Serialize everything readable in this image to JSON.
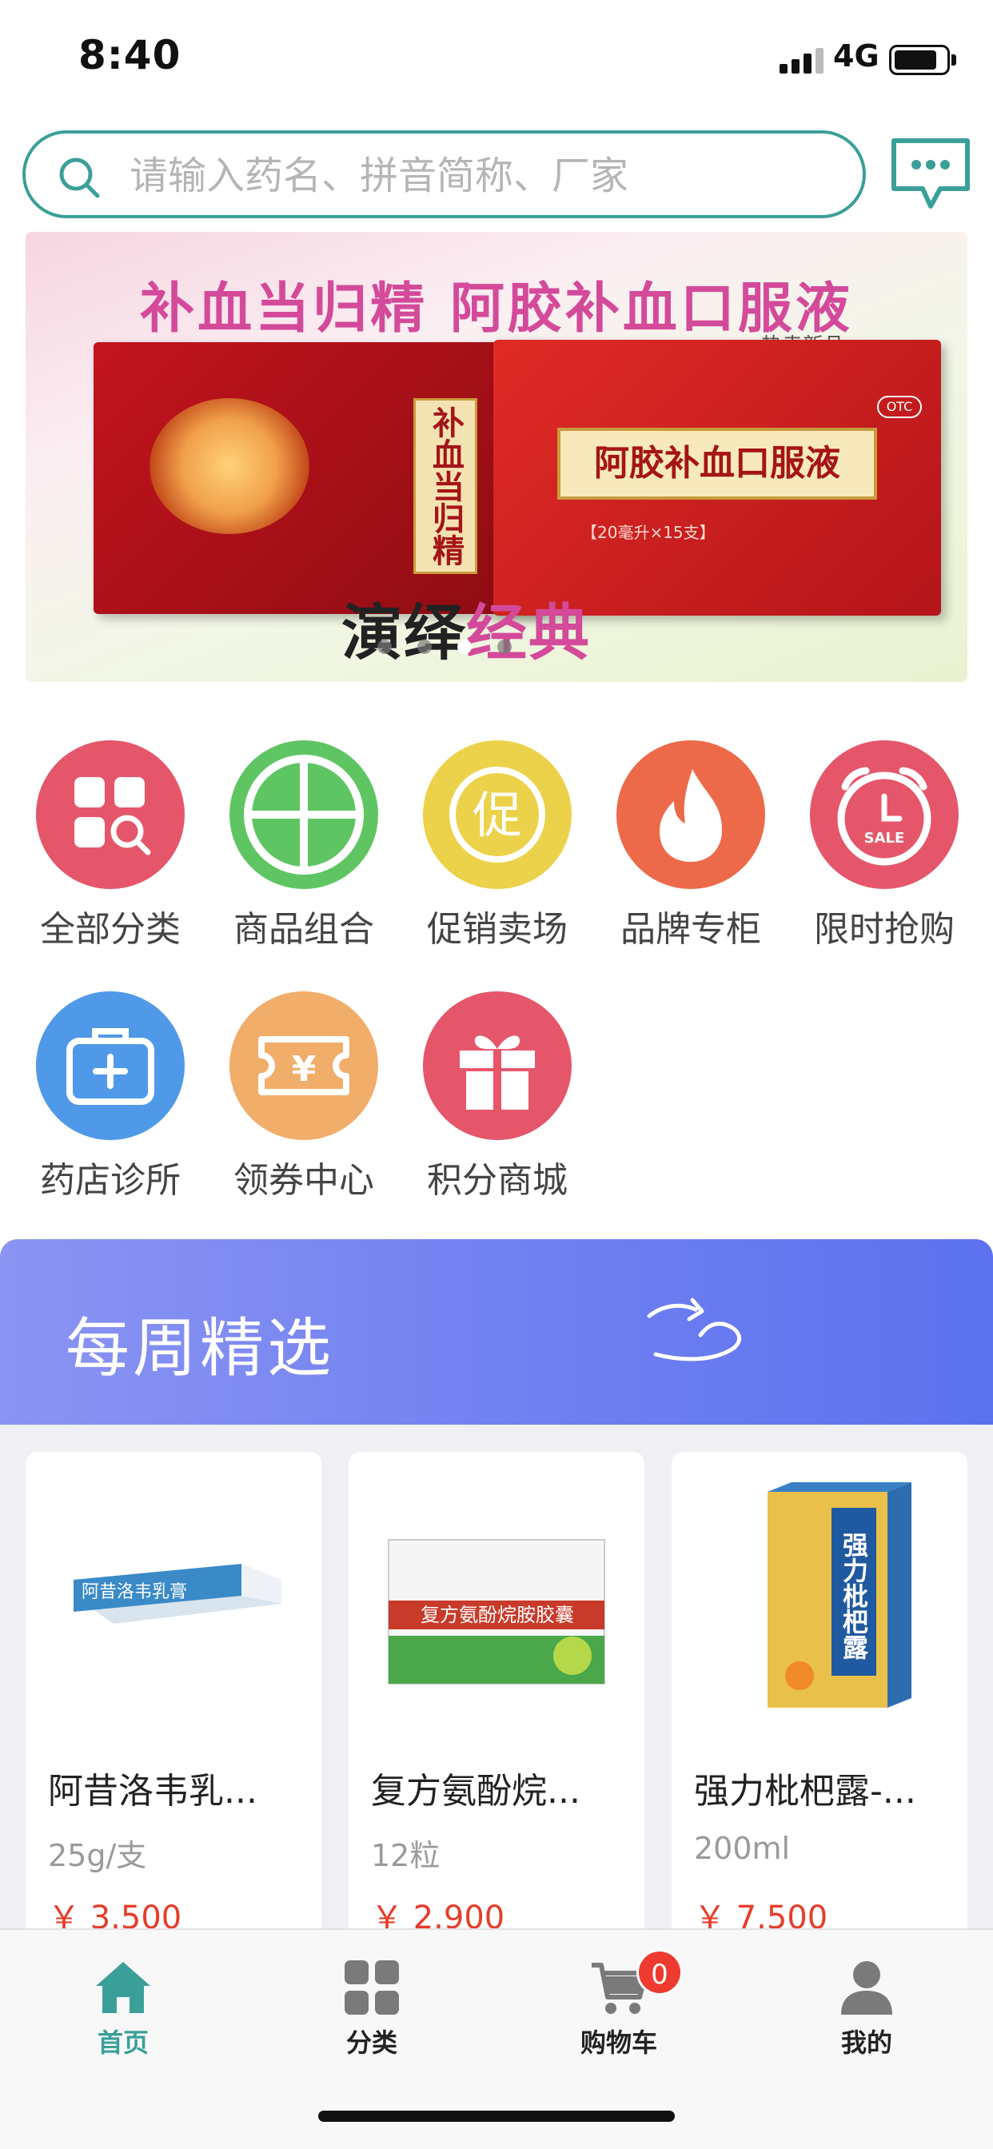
{
  "status_bar": {
    "time": "8:40",
    "network": "4G"
  },
  "search": {
    "placeholder": "请输入药名、拼音简称、厂家"
  },
  "banner": {
    "title": "补血当归精  阿胶补血口服液",
    "hot_tag": "热卖新品",
    "left_box_label": "补血当归精",
    "right_box_label": "阿胶补血口服液",
    "right_box_badge": "OTC",
    "right_box_sub": "【20毫升×15支】",
    "slogan_part1": "演绎",
    "slogan_part2": "经典",
    "page_count": 4,
    "active_page": 3
  },
  "categories": [
    {
      "label": "全部分类",
      "icon": "category-search-icon",
      "color": "#e5566a"
    },
    {
      "label": "商品组合",
      "icon": "grid-window-icon",
      "color": "#5fc563"
    },
    {
      "label": "促销卖场",
      "icon": "promotion-icon",
      "color": "#ecd24a"
    },
    {
      "label": "品牌专柜",
      "icon": "fire-icon",
      "color": "#ec6a4a"
    },
    {
      "label": "限时抢购",
      "icon": "sale-clock-icon",
      "color": "#e5566a"
    },
    {
      "label": "药店诊所",
      "icon": "medical-kit-icon",
      "color": "#4f99e8"
    },
    {
      "label": "领券中心",
      "icon": "coupon-icon",
      "color": "#f1ad6a"
    },
    {
      "label": "积分商城",
      "icon": "gift-icon",
      "color": "#e5566a"
    }
  ],
  "weekly": {
    "title": "每周精选"
  },
  "products": [
    {
      "name": "阿昔洛韦乳...",
      "spec": "25g/支",
      "price": "￥ 3.500",
      "box_text": "阿昔洛韦乳膏"
    },
    {
      "name": "复方氨酚烷...",
      "spec": "12粒",
      "price": "￥ 2.900",
      "box_text": "复方氨酚烷胺胶囊"
    },
    {
      "name": "强力枇杷露-...",
      "spec": "200ml",
      "price": "￥ 7.500",
      "box_text": "强力枇杷露"
    }
  ],
  "tabbar": {
    "items": [
      {
        "label": "首页",
        "icon": "home-icon"
      },
      {
        "label": "分类",
        "icon": "category-icon"
      },
      {
        "label": "购物车",
        "icon": "cart-icon"
      },
      {
        "label": "我的",
        "icon": "user-icon"
      }
    ],
    "cart_count": "0",
    "active_color": "#3a9f98"
  }
}
